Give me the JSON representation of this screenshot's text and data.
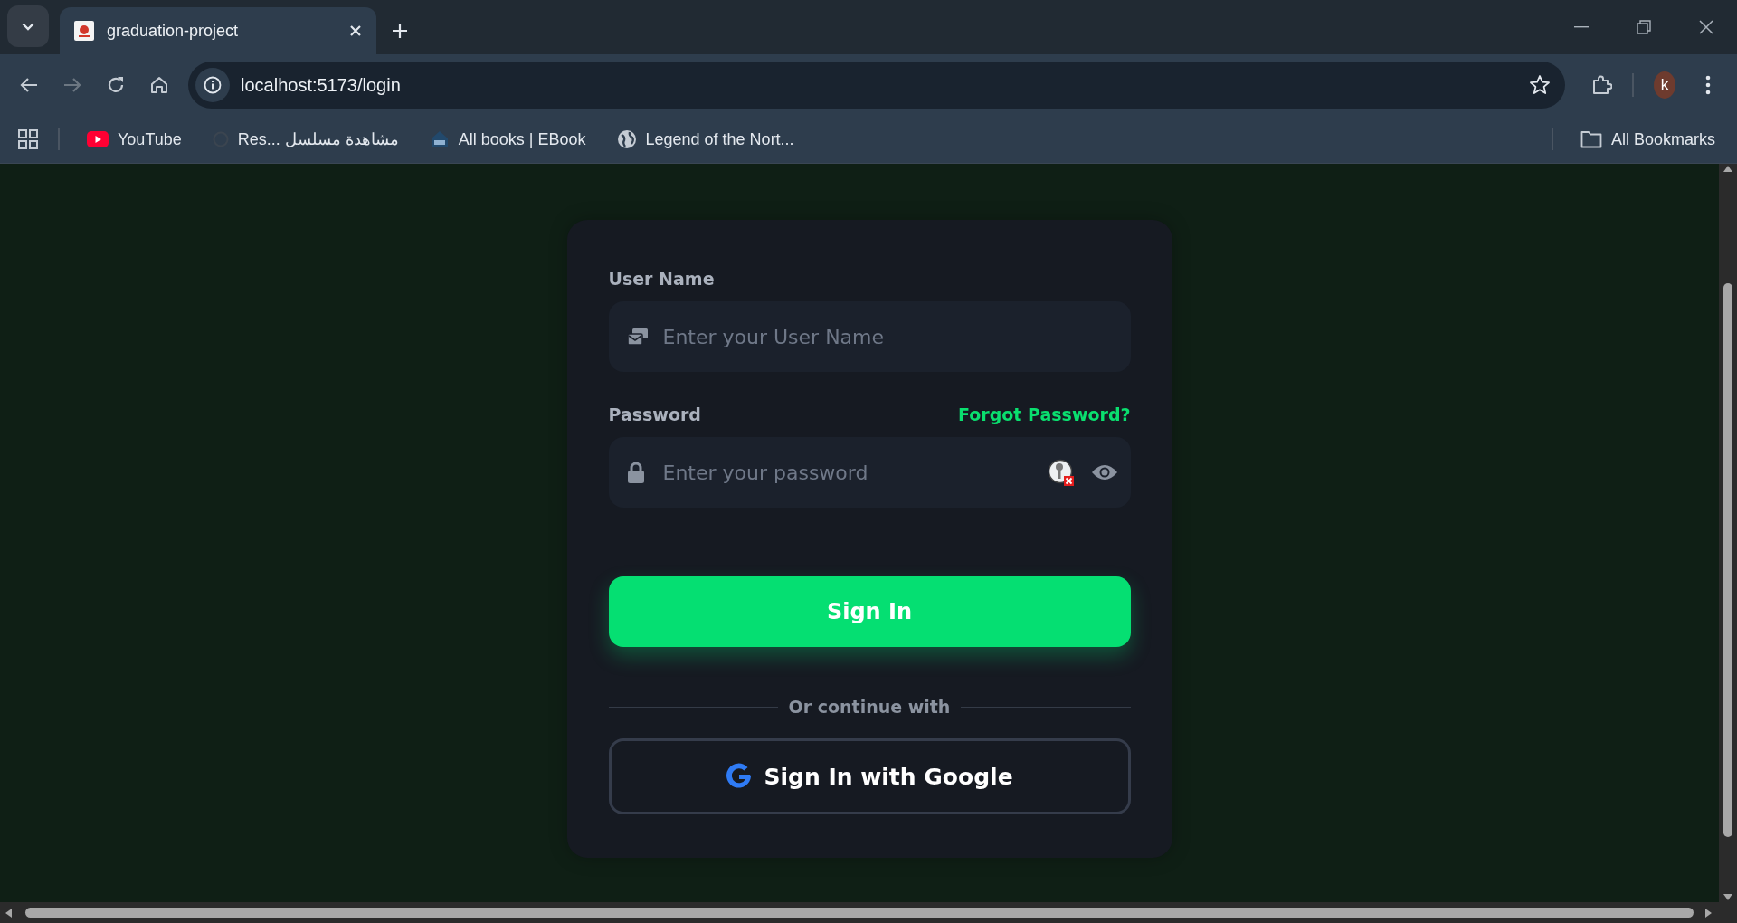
{
  "browser": {
    "tab": {
      "title": "graduation-project",
      "selected": true
    },
    "address": "localhost:5173/login",
    "profile_initial": "k",
    "bookmarks": [
      {
        "label": "YouTube",
        "kind": "youtube"
      },
      {
        "label": "Res... مشاهدة مسلسل",
        "kind": "blank"
      },
      {
        "label": "All books | EBook",
        "kind": "books"
      },
      {
        "label": "Legend of the Nort...",
        "kind": "globe"
      }
    ],
    "all_bookmarks": "All Bookmarks"
  },
  "login": {
    "username": {
      "label": "User Name",
      "placeholder": "Enter your User Name"
    },
    "password": {
      "label": "Password",
      "placeholder": "Enter your password",
      "forgot": "Forgot Password?"
    },
    "sign_in": "Sign In",
    "divider": "Or continue with",
    "google": "Sign In with Google"
  }
}
